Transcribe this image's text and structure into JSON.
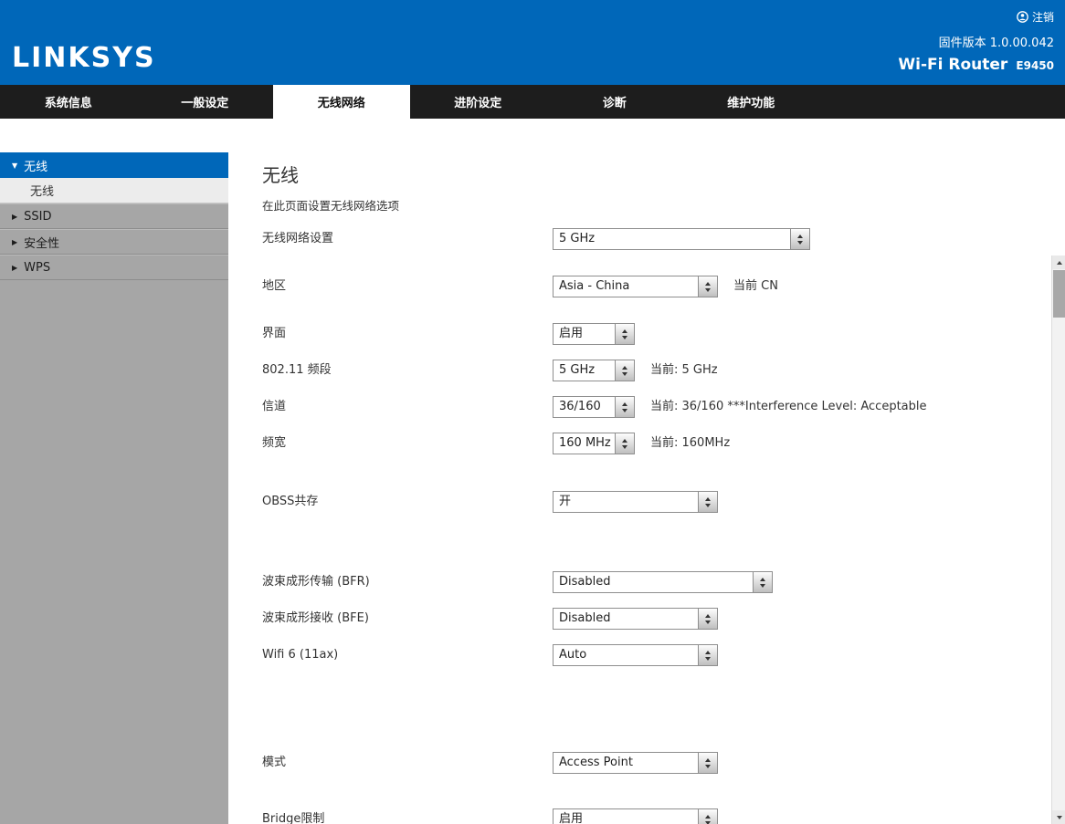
{
  "header": {
    "logo": "LINKSYS",
    "logout_label": "注销",
    "firmware": "固件版本 1.0.00.042",
    "product_name": "Wi-Fi Router",
    "model": "E9450"
  },
  "nav": {
    "tabs": [
      {
        "label": "系统信息",
        "active": false
      },
      {
        "label": "一般设定",
        "active": false
      },
      {
        "label": "无线网络",
        "active": true
      },
      {
        "label": "进阶设定",
        "active": false
      },
      {
        "label": "诊断",
        "active": false
      },
      {
        "label": "维护功能",
        "active": false
      }
    ]
  },
  "sidebar": {
    "items": [
      {
        "label": "无线",
        "type": "active"
      },
      {
        "label": "无线",
        "type": "sub"
      },
      {
        "label": "SSID",
        "type": "collapsed"
      },
      {
        "label": "安全性",
        "type": "collapsed"
      },
      {
        "label": "WPS",
        "type": "collapsed"
      }
    ]
  },
  "main": {
    "title": "无线",
    "subtitle": "在此页面设置无线网络选项",
    "fields": [
      {
        "label": "无线网络设置",
        "value": "5 GHz",
        "note": ""
      },
      {
        "label": "地区",
        "value": "Asia - China",
        "note": "当前 CN"
      },
      {
        "label": "界面",
        "value": "启用",
        "note": ""
      },
      {
        "label": "802.11 频段",
        "value": "5 GHz",
        "note": "当前: 5 GHz"
      },
      {
        "label": "信道",
        "value": "36/160",
        "note": "当前: 36/160 ***Interference Level: Acceptable"
      },
      {
        "label": "频宽",
        "value": "160 MHz",
        "note": "当前: 160MHz"
      },
      {
        "label": "OBSS共存",
        "value": "开",
        "note": ""
      },
      {
        "label": "波束成形传输 (BFR)",
        "value": "Disabled",
        "note": ""
      },
      {
        "label": "波束成形接收 (BFE)",
        "value": "Disabled",
        "note": ""
      },
      {
        "label": "Wifi 6 (11ax)",
        "value": "Auto",
        "note": ""
      },
      {
        "label": "模式",
        "value": "Access Point",
        "note": ""
      },
      {
        "label": "Bridge限制",
        "value": "启用",
        "note": ""
      }
    ]
  },
  "icons": {
    "logout": "user-circle-icon",
    "dropdown": "stepper-arrows-icon",
    "sidebar_expanded": "triangle-down-icon",
    "sidebar_collapsed": "triangle-right-icon"
  }
}
